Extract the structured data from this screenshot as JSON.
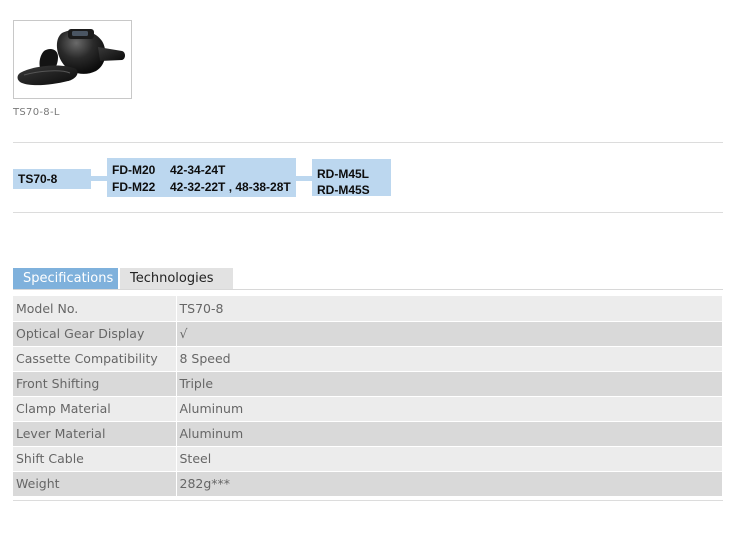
{
  "product": {
    "image_caption": "TS70-8-L"
  },
  "combination": {
    "shifter": "TS70-8",
    "front_derailleurs": [
      {
        "model": "FD-M20",
        "gearing": "42-34-24T"
      },
      {
        "model": "FD-M22",
        "gearing": "42-32-22T , 48-38-28T"
      }
    ],
    "rear_derailleurs": [
      "RD-M45L",
      "RD-M45S"
    ]
  },
  "tabs": [
    {
      "label": "Specifications",
      "active": true
    },
    {
      "label": "Technologies",
      "active": false
    }
  ],
  "specs": [
    {
      "label": "Model No.",
      "value": "TS70-8"
    },
    {
      "label": "Optical Gear Display",
      "value": "√"
    },
    {
      "label": "Cassette Compatibility",
      "value": "8 Speed"
    },
    {
      "label": "Front Shifting",
      "value": "Triple"
    },
    {
      "label": "Clamp Material",
      "value": "Aluminum"
    },
    {
      "label": "Lever Material",
      "value": "Aluminum"
    },
    {
      "label": "Shift Cable",
      "value": "Steel"
    },
    {
      "label": "Weight",
      "value": "282g***"
    }
  ],
  "colors": {
    "tab_active": "#7fb1dc",
    "tab_inactive": "#e2e2e2",
    "combo_box": "#bcd7ef",
    "row_light": "#ececec",
    "row_dark": "#d9d9d9"
  }
}
